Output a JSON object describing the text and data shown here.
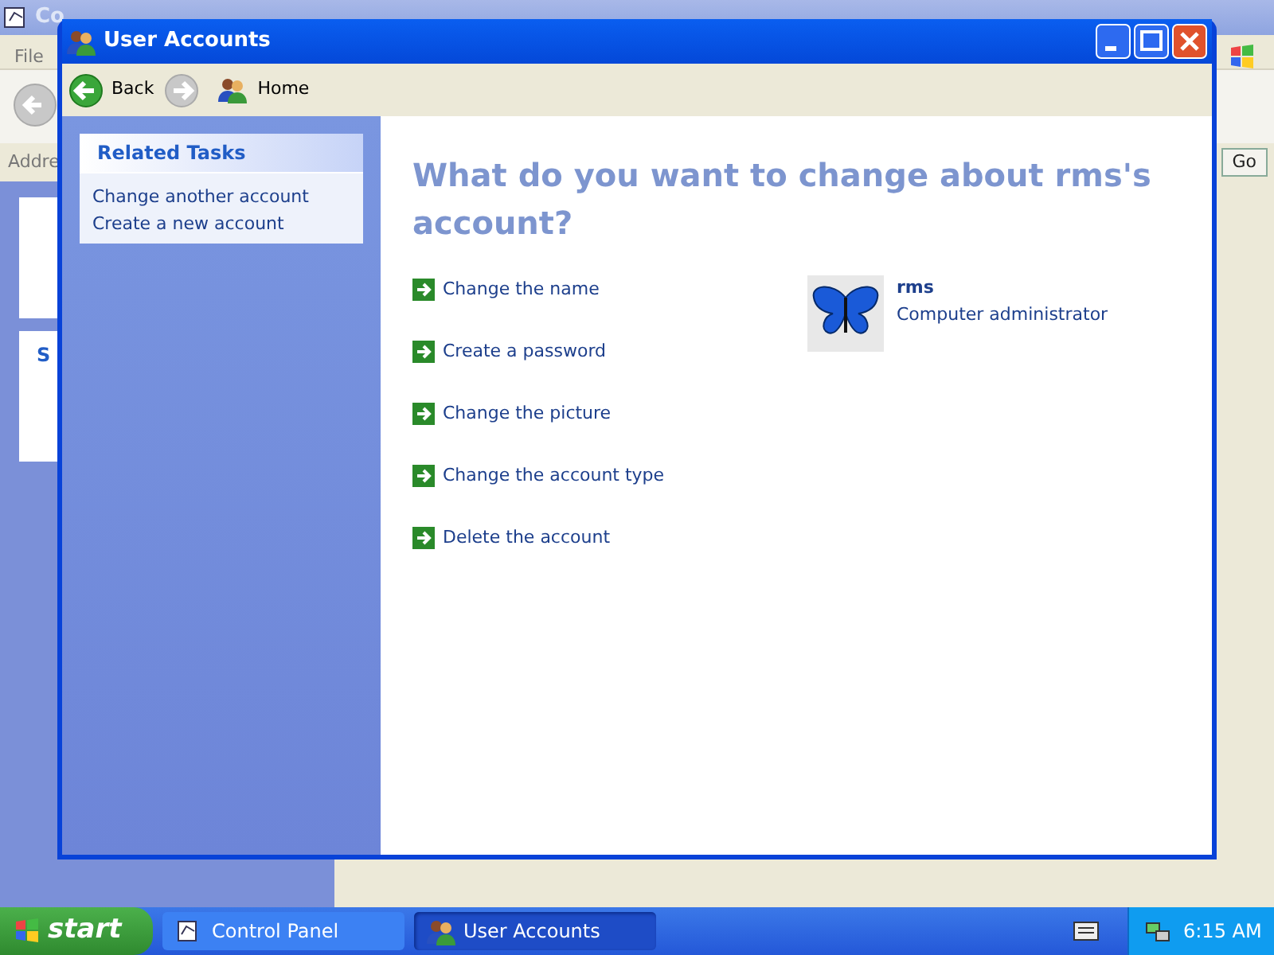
{
  "background_window": {
    "title": "Co",
    "menu": [
      "File"
    ],
    "address_label": "Addre",
    "go_button": "Go",
    "panel_heading": "S"
  },
  "window": {
    "title": "User Accounts"
  },
  "toolbar": {
    "back": "Back",
    "home": "Home"
  },
  "related_tasks": {
    "heading": "Related Tasks",
    "items": [
      "Change another account",
      "Create a new account"
    ]
  },
  "heading": "What do you want to change about rms's account?",
  "tasks": [
    "Change the name",
    "Create a password",
    "Change the picture",
    "Change the account type",
    "Delete the account"
  ],
  "account": {
    "name": "rms",
    "type": "Computer administrator"
  },
  "taskbar": {
    "start": "start",
    "buttons": [
      {
        "label": "Control Panel",
        "selected": false
      },
      {
        "label": "User Accounts",
        "selected": true
      }
    ],
    "clock": "6:15 AM"
  }
}
